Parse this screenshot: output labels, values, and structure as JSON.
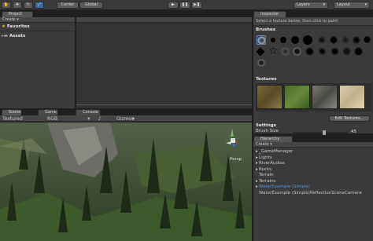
{
  "toolbar": {
    "pivot_mode": "Center",
    "pivot_space": "Global",
    "layers_label": "Layers",
    "layout_label": "Layout"
  },
  "project": {
    "tab": "Project",
    "create": "Create",
    "items": [
      {
        "label": "Favorites",
        "icon": "star-icon"
      },
      {
        "label": "Assets",
        "icon": "folder-icon"
      }
    ]
  },
  "inspector": {
    "tab": "Inspector",
    "hint": "Select a texture below, then click to paint",
    "brushes_title": "Brushes",
    "textures_title": "Textures",
    "edit_textures": "Edit Textures...",
    "settings_title": "Settings",
    "brush_size_label": "Brush Size",
    "brush_size_value": "45",
    "brush_size_fraction": 0.45
  },
  "scene": {
    "tabs": [
      "Scene",
      "Game",
      "Console"
    ],
    "render_mode": "Textured",
    "color_mode": "RGB",
    "gizmos": "Gizmos",
    "persp": "Persp"
  },
  "hierarchy": {
    "tab": "Hierarchy",
    "create": "Create",
    "items": [
      {
        "label": "_GameManager",
        "expandable": true,
        "selected": false
      },
      {
        "label": "Lights",
        "expandable": true,
        "selected": false
      },
      {
        "label": "RiverAudios",
        "expandable": true,
        "selected": false
      },
      {
        "label": "Rocks",
        "expandable": true,
        "selected": false
      },
      {
        "label": "Terrain",
        "expandable": false,
        "selected": false
      },
      {
        "label": "Terrains",
        "expandable": true,
        "selected": false
      },
      {
        "label": "WaterExample (Simple)",
        "expandable": true,
        "selected": true
      },
      {
        "label": "WaterExample (Simple)ReflectionSceneCamera",
        "expandable": false,
        "selected": false
      }
    ]
  },
  "colors": {
    "selection": "#5c8fd6",
    "accent": "#3d6a9c",
    "star": "#f0c030"
  }
}
